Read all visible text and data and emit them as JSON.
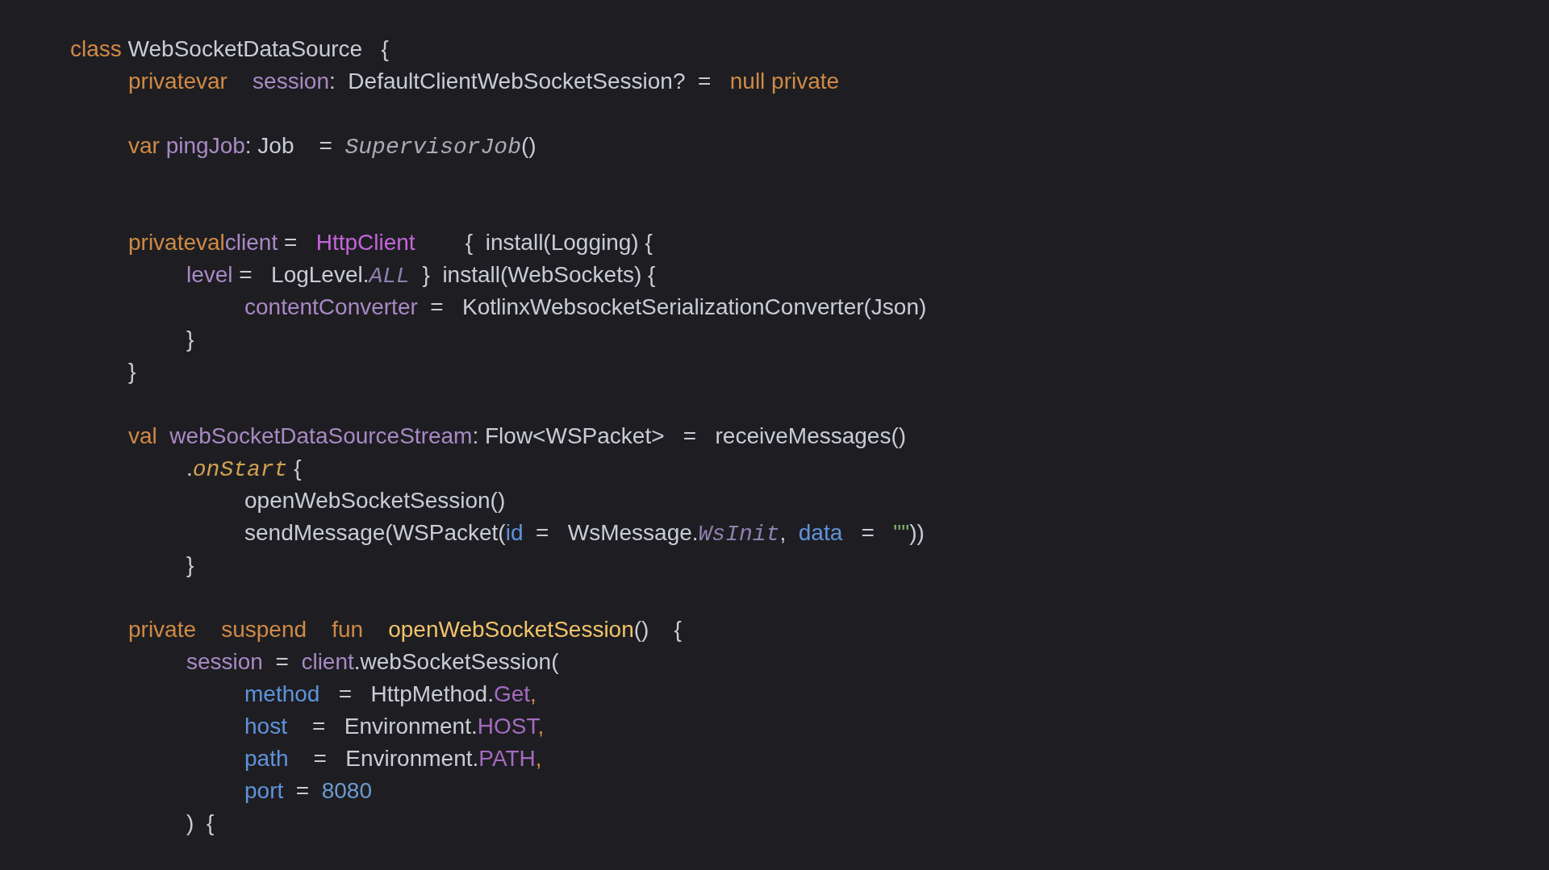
{
  "editor": {
    "lines": [
      {
        "kind": "code",
        "tokens": [
          {
            "text": "class ",
            "kind": "keyword"
          },
          {
            "text": "WebSocketDataSource   {",
            "kind": "plain"
          }
        ],
        "children": [
          {
            "kind": "code",
            "tokens": [
              {
                "text": "privatevar    ",
                "kind": "keyword"
              },
              {
                "text": "session",
                "kind": "property"
              },
              {
                "text": ":  DefaultClientWebSocketSession?  =   ",
                "kind": "plain"
              },
              {
                "text": "null private",
                "kind": "keyword"
              }
            ]
          },
          {
            "kind": "blank"
          },
          {
            "kind": "code",
            "tokens": [
              {
                "text": "var ",
                "kind": "keyword"
              },
              {
                "text": "pingJob",
                "kind": "property"
              },
              {
                "text": ": Job    =  ",
                "kind": "plain"
              },
              {
                "text": "SupervisorJob",
                "kind": "italic"
              },
              {
                "text": "()",
                "kind": "plain"
              }
            ]
          },
          {
            "kind": "blank"
          },
          {
            "kind": "blank"
          },
          {
            "kind": "code",
            "tokens": [
              {
                "text": "privateval",
                "kind": "keyword"
              },
              {
                "text": "client",
                "kind": "property"
              },
              {
                "text": " =   ",
                "kind": "plain"
              },
              {
                "text": "HttpClient",
                "kind": "type"
              },
              {
                "text": "        {  install(Logging) {",
                "kind": "plain"
              }
            ],
            "children": [
              {
                "kind": "code",
                "tokens": [
                  {
                    "text": "level",
                    "kind": "property"
                  },
                  {
                    "text": " =   LogLevel.",
                    "kind": "plain"
                  },
                  {
                    "text": "ALL",
                    "kind": "static"
                  },
                  {
                    "text": "  }  install(WebSockets) {",
                    "kind": "plain"
                  }
                ],
                "children": [
                  {
                    "kind": "code",
                    "tokens": [
                      {
                        "text": "contentConverter",
                        "kind": "property"
                      },
                      {
                        "text": "  =   KotlinxWebsocketSerializationConverter(Json)",
                        "kind": "plain"
                      }
                    ]
                  }
                ]
              },
              {
                "kind": "code",
                "tokens": [
                  {
                    "text": "}",
                    "kind": "plain"
                  }
                ]
              }
            ]
          },
          {
            "kind": "code",
            "tokens": [
              {
                "text": "}",
                "kind": "plain"
              }
            ]
          },
          {
            "kind": "blank"
          },
          {
            "kind": "code",
            "tokens": [
              {
                "text": "val  ",
                "kind": "keyword"
              },
              {
                "text": "webSocketDataSourceStream",
                "kind": "property"
              },
              {
                "text": ": Flow<WSPacket>   =   receiveMessages()",
                "kind": "plain"
              }
            ],
            "children": [
              {
                "kind": "code",
                "tokens": [
                  {
                    "text": ".",
                    "kind": "plain"
                  },
                  {
                    "text": "onStart",
                    "kind": "call"
                  },
                  {
                    "text": " {",
                    "kind": "plain"
                  }
                ],
                "children": [
                  {
                    "kind": "code",
                    "tokens": [
                      {
                        "text": "openWebSocketSession()",
                        "kind": "plain"
                      }
                    ]
                  },
                  {
                    "kind": "code",
                    "tokens": [
                      {
                        "text": "sendMessage(WSPacket(",
                        "kind": "plain"
                      },
                      {
                        "text": "id",
                        "kind": "argument"
                      },
                      {
                        "text": "  =   WsMessage.",
                        "kind": "plain"
                      },
                      {
                        "text": "WsInit",
                        "kind": "static"
                      },
                      {
                        "text": ",  ",
                        "kind": "plain"
                      },
                      {
                        "text": "data",
                        "kind": "argument"
                      },
                      {
                        "text": "   =   ",
                        "kind": "plain"
                      },
                      {
                        "text": "\"\"",
                        "kind": "string"
                      },
                      {
                        "text": "))",
                        "kind": "plain"
                      }
                    ]
                  }
                ]
              },
              {
                "kind": "code",
                "tokens": [
                  {
                    "text": "}",
                    "kind": "plain"
                  }
                ]
              }
            ]
          },
          {
            "kind": "blank"
          },
          {
            "kind": "code",
            "tokens": [
              {
                "text": "private    suspend    fun    ",
                "kind": "keyword"
              },
              {
                "text": "openWebSocketSession",
                "kind": "function"
              },
              {
                "text": "()    {",
                "kind": "plain"
              }
            ],
            "children": [
              {
                "kind": "code",
                "tokens": [
                  {
                    "text": "session",
                    "kind": "property"
                  },
                  {
                    "text": "  =  ",
                    "kind": "plain"
                  },
                  {
                    "text": "client",
                    "kind": "property"
                  },
                  {
                    "text": ".webSocketSession(",
                    "kind": "plain"
                  }
                ],
                "children": [
                  {
                    "kind": "code",
                    "tokens": [
                      {
                        "text": "method",
                        "kind": "argument"
                      },
                      {
                        "text": "   =   HttpMethod.",
                        "kind": "plain"
                      },
                      {
                        "text": "Get",
                        "kind": "constant"
                      },
                      {
                        "text": ",",
                        "kind": "keyword"
                      }
                    ]
                  },
                  {
                    "kind": "code",
                    "tokens": [
                      {
                        "text": "host",
                        "kind": "argument"
                      },
                      {
                        "text": "    =   Environment.",
                        "kind": "plain"
                      },
                      {
                        "text": "HOST",
                        "kind": "constant"
                      },
                      {
                        "text": ",",
                        "kind": "keyword"
                      }
                    ]
                  },
                  {
                    "kind": "code",
                    "tokens": [
                      {
                        "text": "path",
                        "kind": "argument"
                      },
                      {
                        "text": "    =   Environment.",
                        "kind": "plain"
                      },
                      {
                        "text": "PATH",
                        "kind": "constant"
                      },
                      {
                        "text": ",",
                        "kind": "keyword"
                      }
                    ]
                  },
                  {
                    "kind": "code",
                    "tokens": [
                      {
                        "text": "port",
                        "kind": "argument"
                      },
                      {
                        "text": "  =  ",
                        "kind": "plain"
                      },
                      {
                        "text": "8080",
                        "kind": "number"
                      }
                    ]
                  }
                ]
              },
              {
                "kind": "code",
                "tokens": [
                  {
                    "text": ")  {",
                    "kind": "plain"
                  }
                ]
              }
            ]
          }
        ]
      }
    ]
  }
}
